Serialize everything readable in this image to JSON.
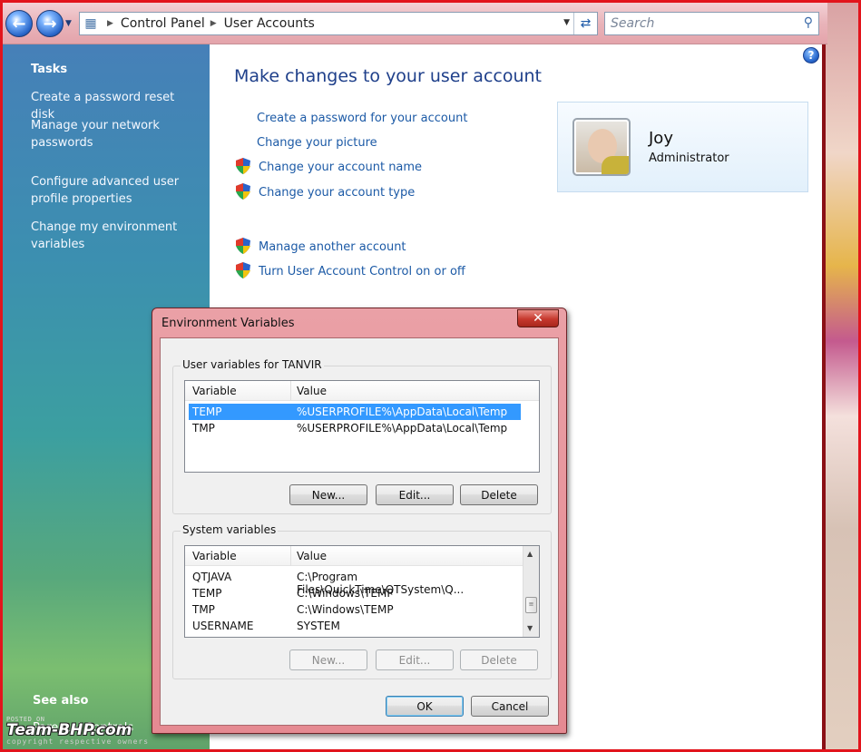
{
  "address_bar": {
    "crumbs": [
      "Control Panel",
      "User Accounts"
    ],
    "search_placeholder": "Search"
  },
  "tasks": {
    "heading": "Tasks",
    "links": [
      "Create a password reset disk",
      "Manage your network passwords",
      "Configure advanced user profile properties",
      "Change my environment variables"
    ],
    "see_also": "See also",
    "parental_controls": "Parental Controls"
  },
  "main": {
    "title": "Make changes to your user account",
    "links": [
      "Create a password for your account",
      "Change your picture",
      "Change your account name",
      "Change your account type",
      "Manage another account",
      "Turn User Account Control on or off"
    ]
  },
  "user": {
    "name": "Joy",
    "role": "Administrator"
  },
  "dialog": {
    "title": "Environment Variables",
    "close_label": "✕",
    "user_group_label": "User variables for TANVIR",
    "system_group_label": "System variables",
    "col_variable": "Variable",
    "col_value": "Value",
    "user_vars": [
      {
        "variable": "TEMP",
        "value": "%USERPROFILE%\\AppData\\Local\\Temp"
      },
      {
        "variable": "TMP",
        "value": "%USERPROFILE%\\AppData\\Local\\Temp"
      }
    ],
    "system_vars": [
      {
        "variable": "QTJAVA",
        "value": "C:\\Program Files\\QuickTime\\QTSystem\\Q..."
      },
      {
        "variable": "TEMP",
        "value": "C:\\Windows\\TEMP"
      },
      {
        "variable": "TMP",
        "value": "C:\\Windows\\TEMP"
      },
      {
        "variable": "USERNAME",
        "value": "SYSTEM"
      }
    ],
    "buttons": {
      "new": "New...",
      "edit": "Edit...",
      "delete": "Delete",
      "ok": "OK",
      "cancel": "Cancel"
    }
  },
  "watermark": {
    "posted_on": "POSTED ON",
    "brand": "Team-BHP.com",
    "copyright": "copyright respective owners"
  }
}
